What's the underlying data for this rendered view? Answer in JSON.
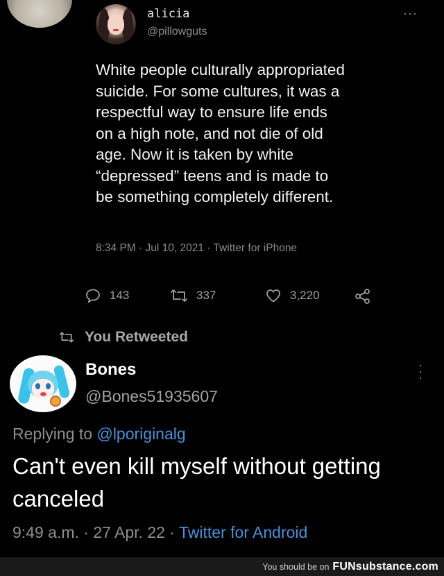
{
  "quoted_tweet": {
    "name": "alicia",
    "handle": "@pillowguts",
    "more": "···",
    "text": "White people culturally appropriated\nsuicide. For some cultures, it was a\nrespectful way to ensure life ends\non a high note, and not die of old\nage. Now it is taken by white\n“depressed” teens and is made to\nbe something completely different.",
    "meta": "8:34 PM · Jul 10, 2021 · Twitter for iPhone",
    "replies": "143",
    "retweets": "337",
    "likes": "3,220"
  },
  "retweet_label": "You Retweeted",
  "reply_tweet": {
    "name": "Bones",
    "handle": "@Bones51935607",
    "replying_prefix": "Replying to ",
    "replying_mention": "@lporiginalg",
    "text": "Can't even kill myself without getting canceled",
    "meta_prefix": "9:49 a.m. · 27 Apr. 22 · ",
    "meta_source": "Twitter for Android"
  },
  "watermark": {
    "prefix": "You should be on",
    "logo": "FUNsubstance.com"
  },
  "colors": {
    "background": "#000000",
    "link_blue": "#4d8fd8",
    "muted_text": "#8e8e8e"
  },
  "icons": [
    "reply-icon",
    "retweet-icon",
    "like-icon",
    "share-icon",
    "more-icon"
  ]
}
